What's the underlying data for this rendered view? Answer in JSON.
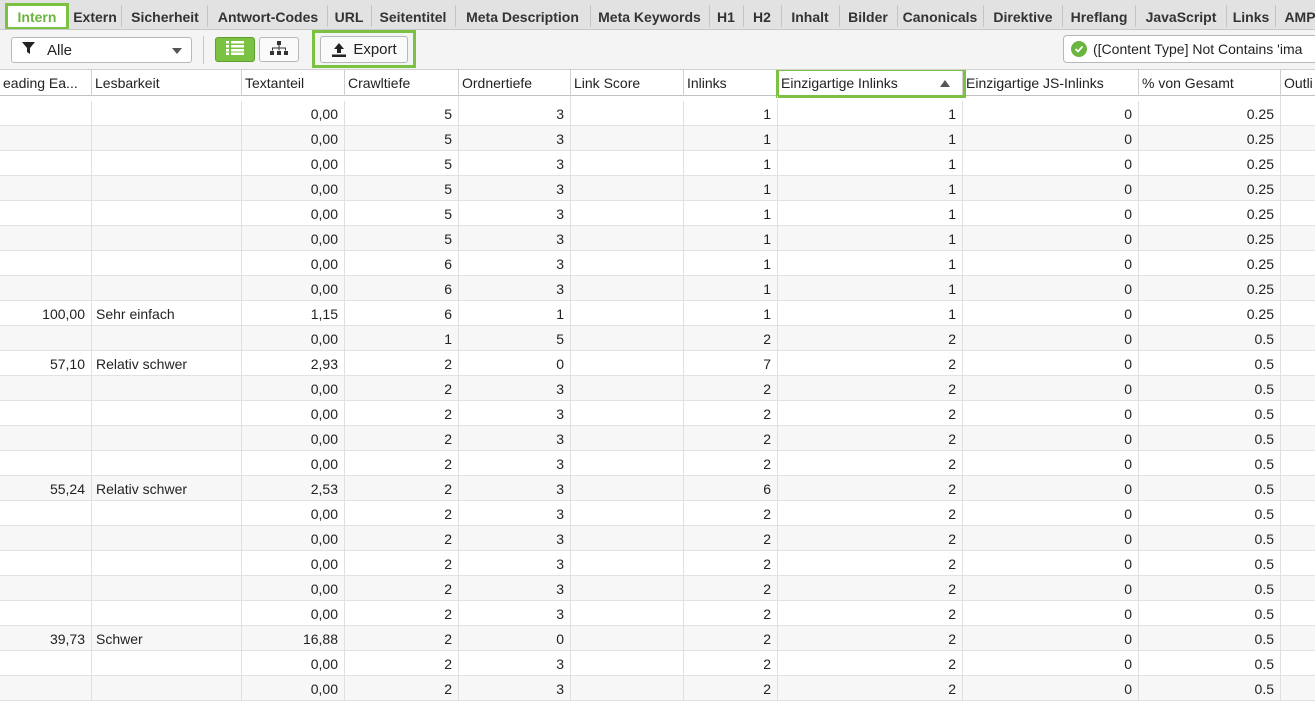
{
  "tabs": [
    {
      "label": "Intern",
      "active": true
    },
    {
      "label": "Extern"
    },
    {
      "label": "Sicherheit"
    },
    {
      "label": "Antwort-Codes"
    },
    {
      "label": "URL"
    },
    {
      "label": "Seitentitel"
    },
    {
      "label": "Meta Description"
    },
    {
      "label": "Meta Keywords"
    },
    {
      "label": "H1"
    },
    {
      "label": "H2"
    },
    {
      "label": "Inhalt"
    },
    {
      "label": "Bilder"
    },
    {
      "label": "Canonicals"
    },
    {
      "label": "Direktive"
    },
    {
      "label": "Hreflang"
    },
    {
      "label": "JavaScript"
    },
    {
      "label": "Links"
    },
    {
      "label": "AMP"
    }
  ],
  "toolbar": {
    "filter_value": "Alle",
    "export_label": "Export",
    "filter_chip": "([Content Type] Not Contains 'ima"
  },
  "columns": [
    "eading Ea...",
    "Lesbarkeit",
    "Textanteil",
    "Crawltiefe",
    "Ordnertiefe",
    "Link Score",
    "Inlinks",
    "Einzigartige Inlinks",
    "Einzigartige JS-Inlinks",
    "% von Gesamt",
    "Outli"
  ],
  "sorted_column": "Einzigartige Inlinks",
  "rows": [
    [
      "",
      "",
      "0,00",
      "5",
      "3",
      "",
      "1",
      "1",
      "0",
      "0.25"
    ],
    [
      "",
      "",
      "0,00",
      "5",
      "3",
      "",
      "1",
      "1",
      "0",
      "0.25"
    ],
    [
      "",
      "",
      "0,00",
      "5",
      "3",
      "",
      "1",
      "1",
      "0",
      "0.25"
    ],
    [
      "",
      "",
      "0,00",
      "5",
      "3",
      "",
      "1",
      "1",
      "0",
      "0.25"
    ],
    [
      "",
      "",
      "0,00",
      "5",
      "3",
      "",
      "1",
      "1",
      "0",
      "0.25"
    ],
    [
      "",
      "",
      "0,00",
      "5",
      "3",
      "",
      "1",
      "1",
      "0",
      "0.25"
    ],
    [
      "",
      "",
      "0,00",
      "6",
      "3",
      "",
      "1",
      "1",
      "0",
      "0.25"
    ],
    [
      "",
      "",
      "0,00",
      "6",
      "3",
      "",
      "1",
      "1",
      "0",
      "0.25"
    ],
    [
      "100,00",
      "Sehr einfach",
      "1,15",
      "6",
      "1",
      "",
      "1",
      "1",
      "0",
      "0.25"
    ],
    [
      "",
      "",
      "0,00",
      "1",
      "5",
      "",
      "2",
      "2",
      "0",
      "0.5"
    ],
    [
      "57,10",
      "Relativ schwer",
      "2,93",
      "2",
      "0",
      "",
      "7",
      "2",
      "0",
      "0.5"
    ],
    [
      "",
      "",
      "0,00",
      "2",
      "3",
      "",
      "2",
      "2",
      "0",
      "0.5"
    ],
    [
      "",
      "",
      "0,00",
      "2",
      "3",
      "",
      "2",
      "2",
      "0",
      "0.5"
    ],
    [
      "",
      "",
      "0,00",
      "2",
      "3",
      "",
      "2",
      "2",
      "0",
      "0.5"
    ],
    [
      "",
      "",
      "0,00",
      "2",
      "3",
      "",
      "2",
      "2",
      "0",
      "0.5"
    ],
    [
      "55,24",
      "Relativ schwer",
      "2,53",
      "2",
      "3",
      "",
      "6",
      "2",
      "0",
      "0.5"
    ],
    [
      "",
      "",
      "0,00",
      "2",
      "3",
      "",
      "2",
      "2",
      "0",
      "0.5"
    ],
    [
      "",
      "",
      "0,00",
      "2",
      "3",
      "",
      "2",
      "2",
      "0",
      "0.5"
    ],
    [
      "",
      "",
      "0,00",
      "2",
      "3",
      "",
      "2",
      "2",
      "0",
      "0.5"
    ],
    [
      "",
      "",
      "0,00",
      "2",
      "3",
      "",
      "2",
      "2",
      "0",
      "0.5"
    ],
    [
      "",
      "",
      "0,00",
      "2",
      "3",
      "",
      "2",
      "2",
      "0",
      "0.5"
    ],
    [
      "39,73",
      "Schwer",
      "16,88",
      "2",
      "0",
      "",
      "2",
      "2",
      "0",
      "0.5"
    ],
    [
      "",
      "",
      "0,00",
      "2",
      "3",
      "",
      "2",
      "2",
      "0",
      "0.5"
    ],
    [
      "",
      "",
      "0,00",
      "2",
      "3",
      "",
      "2",
      "2",
      "0",
      "0.5"
    ]
  ],
  "colors": {
    "accent_green": "#7cc242",
    "check_green": "#6ab53f"
  },
  "icons": {
    "filter": "funnel-icon",
    "list_view": "list-icon",
    "tree_view": "tree-icon",
    "export": "upload-icon",
    "filter_status": "check-circle-icon",
    "sort": "sort-ascending-icon"
  }
}
